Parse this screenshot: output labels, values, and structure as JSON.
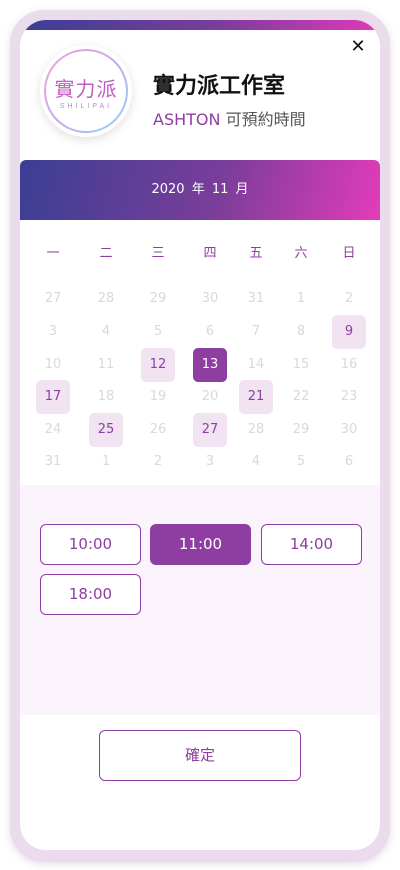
{
  "dialog": {
    "close_icon": "close-icon",
    "close_symbol": "✕"
  },
  "studio": {
    "logo_main": "實力派",
    "logo_sub": "SHILIPAI",
    "title": "實力派工作室",
    "teacher": "ASHTON",
    "subtitle_suffix": "可預約時間"
  },
  "calendar": {
    "month_label": "2020 年 11 月",
    "weekdays": [
      "一",
      "二",
      "三",
      "四",
      "五",
      "六",
      "日"
    ],
    "weeks": [
      [
        {
          "d": "27",
          "s": "muted"
        },
        {
          "d": "28",
          "s": "muted"
        },
        {
          "d": "29",
          "s": "muted"
        },
        {
          "d": "30",
          "s": "muted"
        },
        {
          "d": "31",
          "s": "muted"
        },
        {
          "d": "1",
          "s": "muted"
        },
        {
          "d": "2",
          "s": "muted"
        }
      ],
      [
        {
          "d": "3",
          "s": "muted"
        },
        {
          "d": "4",
          "s": "muted"
        },
        {
          "d": "5",
          "s": "muted"
        },
        {
          "d": "6",
          "s": "muted"
        },
        {
          "d": "7",
          "s": "muted"
        },
        {
          "d": "8",
          "s": "muted"
        },
        {
          "d": "9",
          "s": "avail"
        }
      ],
      [
        {
          "d": "10",
          "s": "muted"
        },
        {
          "d": "11",
          "s": "muted"
        },
        {
          "d": "12",
          "s": "avail"
        },
        {
          "d": "13",
          "s": "sel"
        },
        {
          "d": "14",
          "s": "muted"
        },
        {
          "d": "15",
          "s": "muted"
        },
        {
          "d": "16",
          "s": "muted"
        }
      ],
      [
        {
          "d": "17",
          "s": "avail"
        },
        {
          "d": "18",
          "s": "muted"
        },
        {
          "d": "19",
          "s": "muted"
        },
        {
          "d": "20",
          "s": "muted"
        },
        {
          "d": "21",
          "s": "avail"
        },
        {
          "d": "22",
          "s": "muted"
        },
        {
          "d": "23",
          "s": "muted"
        }
      ],
      [
        {
          "d": "24",
          "s": "muted"
        },
        {
          "d": "25",
          "s": "avail"
        },
        {
          "d": "26",
          "s": "muted"
        },
        {
          "d": "27",
          "s": "avail"
        },
        {
          "d": "28",
          "s": "muted"
        },
        {
          "d": "29",
          "s": "muted"
        },
        {
          "d": "30",
          "s": "muted"
        }
      ],
      [
        {
          "d": "31",
          "s": "muted"
        },
        {
          "d": "1",
          "s": "muted"
        },
        {
          "d": "2",
          "s": "muted"
        },
        {
          "d": "3",
          "s": "muted"
        },
        {
          "d": "4",
          "s": "muted"
        },
        {
          "d": "5",
          "s": "muted"
        },
        {
          "d": "6",
          "s": "muted"
        }
      ]
    ]
  },
  "time_slots": [
    {
      "label": "10:00",
      "selected": false
    },
    {
      "label": "11:00",
      "selected": true
    },
    {
      "label": "14:00",
      "selected": false
    },
    {
      "label": "18:00",
      "selected": false
    }
  ],
  "confirm_label": "確定",
  "colors": {
    "accent": "#8e3ea1",
    "available_bg": "#f1e3f2",
    "muted_text": "#d9d9d9",
    "panel_bg": "#fcf4fc"
  }
}
